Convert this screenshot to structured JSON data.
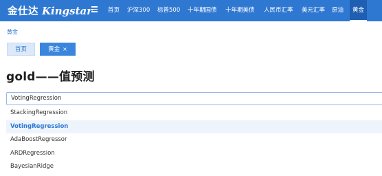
{
  "header": {
    "logo_cn": "金仕达",
    "logo_en": "Kingstar",
    "nav": [
      {
        "label": "首页"
      },
      {
        "label": "沪深300"
      },
      {
        "label": "标普500"
      },
      {
        "label": "十年期国债"
      },
      {
        "label": "十年期美债"
      },
      {
        "label": "人民币汇率"
      },
      {
        "label": "美元汇率"
      },
      {
        "label": "原油"
      },
      {
        "label": "黄金",
        "active": true
      }
    ]
  },
  "breadcrumb": "黄金",
  "tabs": [
    {
      "label": "首页"
    },
    {
      "label": "黄金",
      "close": "×",
      "active": true
    }
  ],
  "page_title": "gold——值预测",
  "model_select": {
    "value": "VotingRegression",
    "options": [
      "StackingRegression",
      "VotingRegression",
      "AdaBoostRegressor",
      "ARDRegression",
      "BayesianRidge"
    ],
    "selected_index": 1
  },
  "colors": {
    "nav_bg": "#2f78d2",
    "accent": "#2f78d2",
    "active_tab": "#3a86dd"
  },
  "icons": {
    "menu": "hamburger-menu-icon"
  }
}
